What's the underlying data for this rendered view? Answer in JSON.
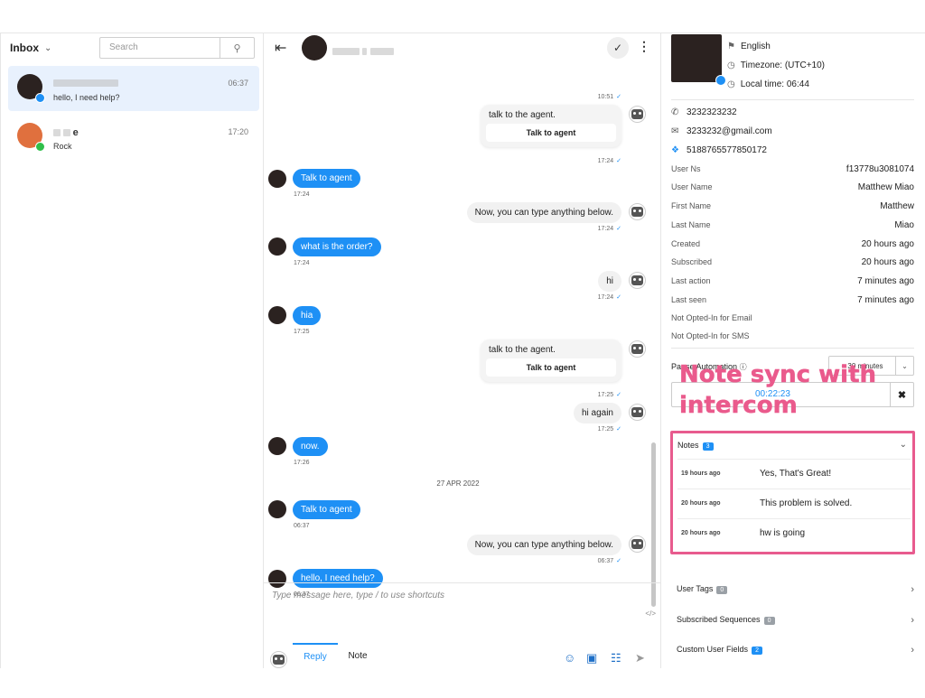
{
  "inbox": {
    "title": "Inbox",
    "search_placeholder": "Search",
    "conversations": [
      {
        "preview": "hello, I need help?",
        "time": "06:37",
        "channel": "messenger"
      },
      {
        "name_suffix": "e",
        "preview": "Rock",
        "time": "17:20",
        "channel": "line"
      }
    ]
  },
  "thread": {
    "messages": [
      {
        "from": "bot",
        "type": "card",
        "text": "talk to the agent.",
        "button": "Talk to agent",
        "time": "17:24"
      },
      {
        "from": "user",
        "text": "Talk to agent",
        "time": "17:24"
      },
      {
        "from": "bot",
        "text": "Now, you can type anything below.",
        "time": "17:24"
      },
      {
        "from": "user",
        "text": "what is the order?",
        "time": "17:24"
      },
      {
        "from": "bot",
        "text": "hi",
        "time": "17:24"
      },
      {
        "from": "user",
        "text": "hia",
        "time": "17:25"
      },
      {
        "from": "bot",
        "type": "card",
        "text": "talk to the agent.",
        "button": "Talk to agent",
        "time": "17:25"
      },
      {
        "from": "bot",
        "text": "hi again",
        "time": "17:25"
      },
      {
        "from": "user",
        "text": "now.",
        "time": "17:26"
      },
      {
        "from": "user",
        "text": "Talk to agent",
        "time": "06:37"
      },
      {
        "from": "bot",
        "text": "Now, you can type anything below.",
        "time": "06:37"
      },
      {
        "from": "user",
        "text": "hello, I need help?",
        "time": "06:37"
      }
    ],
    "top_time": "10:51",
    "date_separator": "27 APR 2022"
  },
  "composer": {
    "placeholder": "Type message here, type / to use shortcuts",
    "code_toggle": "</>",
    "tab_reply": "Reply",
    "tab_note": "Note"
  },
  "profile": {
    "language": "English",
    "timezone": "Timezone: (UTC+10)",
    "local_time": "Local time: 06:44",
    "phone": "3232323232",
    "email": "3233232@gmail.com",
    "messenger_id": "5188765577850172",
    "attributes": [
      {
        "label": "User Ns",
        "value": "f13778u3081074"
      },
      {
        "label": "User Name",
        "value": "Matthew Miao"
      },
      {
        "label": "First Name",
        "value": "Matthew"
      },
      {
        "label": "Last Name",
        "value": "Miao"
      },
      {
        "label": "Created",
        "value": "20 hours ago"
      },
      {
        "label": "Subscribed",
        "value": "20 hours ago"
      },
      {
        "label": "Last action",
        "value": "7 minutes ago"
      },
      {
        "label": "Last seen",
        "value": "7 minutes ago"
      },
      {
        "label": "Not Opted-In for Email",
        "value": ""
      },
      {
        "label": "Not Opted-In for SMS",
        "value": ""
      }
    ]
  },
  "automation": {
    "label": "Pause Automation",
    "selected": "+ 30 minutes",
    "timer": "00:22:23"
  },
  "callout": {
    "line1": "Note sync with",
    "line2": "intercom",
    "color": "#ea5a8c"
  },
  "notes": {
    "title": "Notes",
    "count": "3",
    "items": [
      {
        "when": "19 hours ago",
        "text": "Yes, That's Great!"
      },
      {
        "when": "20 hours ago",
        "text": "This problem is solved."
      },
      {
        "when": "20 hours ago",
        "text": "hw is going"
      }
    ]
  },
  "sections": [
    {
      "label": "User Tags",
      "count": "0"
    },
    {
      "label": "Subscribed Sequences",
      "count": "0"
    },
    {
      "label": "Custom User Fields",
      "count": "2"
    }
  ],
  "colors": {
    "accent": "#1e90f5",
    "highlight_border": "#e85b8e",
    "active_row": "#e8f1fd"
  }
}
